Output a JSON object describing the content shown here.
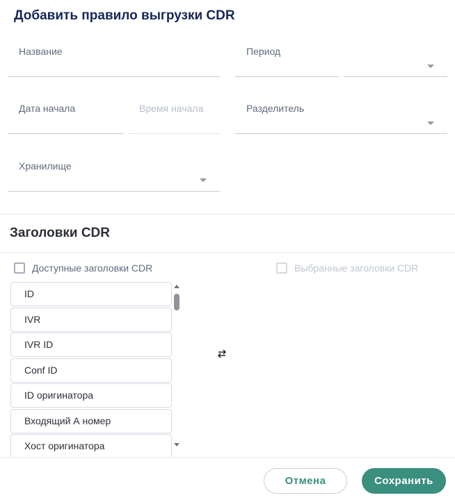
{
  "dialog": {
    "title": "Добавить правило выгрузки CDR"
  },
  "form": {
    "name_label": "Название",
    "period_label": "Период",
    "start_date_label": "Дата начала",
    "start_time_label": "Время начала",
    "separator_label": "Разделитель",
    "storage_label": "Хранилище"
  },
  "headers": {
    "title": "Заголовки CDR",
    "available_label": "Доступные заголовки CDR",
    "selected_label": "Выбранные заголовки CDR",
    "available_items": [
      "ID",
      "IVR",
      "IVR ID",
      "Conf ID",
      "ID оригинатора",
      "Входящий А номер",
      "Хост оригинатора"
    ]
  },
  "actions": {
    "cancel": "Отмена",
    "save": "Сохранить"
  },
  "colors": {
    "title": "#16265a",
    "accent": "#3b8f7e",
    "muted": "#5f6b7c"
  },
  "icons": {
    "dropdown": "chevron-down-icon",
    "swap": "swap-arrows-icon"
  }
}
